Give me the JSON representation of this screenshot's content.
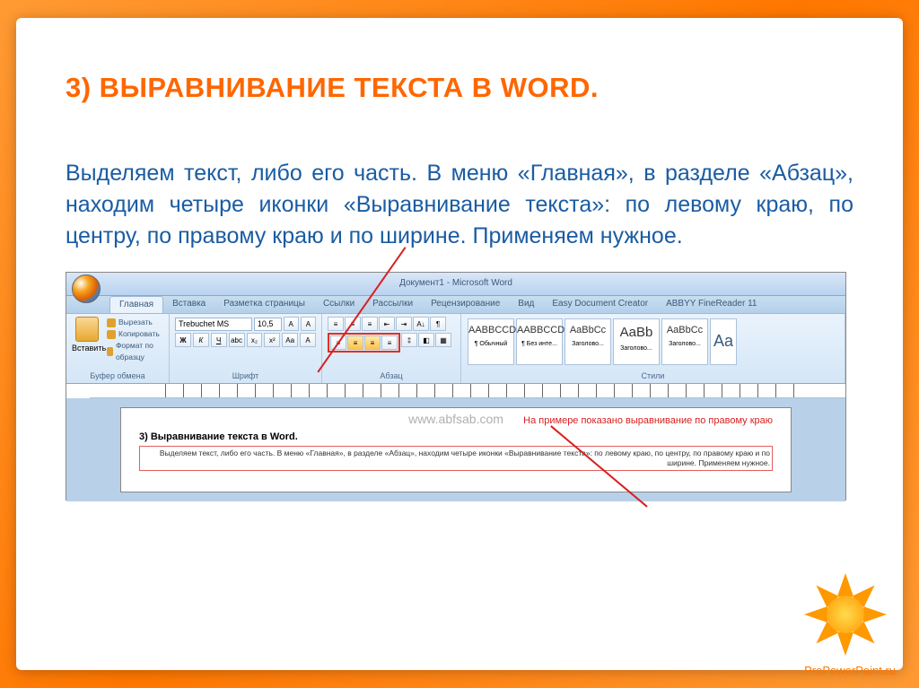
{
  "slide": {
    "title": "3) ВЫРАВНИВАНИЕ ТЕКСТА В WORD.",
    "body": "Выделяем текст, либо его часть. В меню «Главная», в разделе «Абзац», находим четыре иконки «Выравнивание текста»: по левому краю, по центру, по правому краю и по ширине. Применяем нужное."
  },
  "word": {
    "window_title": "Документ1 - Microsoft Word",
    "tabs": [
      "Главная",
      "Вставка",
      "Разметка страницы",
      "Ссылки",
      "Рассылки",
      "Рецензирование",
      "Вид",
      "Easy Document Creator",
      "ABBYY FineReader 11"
    ],
    "clipboard": {
      "paste": "Вставить",
      "cut": "Вырезать",
      "copy": "Копировать",
      "format": "Формат по образцу",
      "group": "Буфер обмена"
    },
    "font": {
      "name": "Trebuchet MS",
      "size": "10,5",
      "group": "Шрифт"
    },
    "paragraph": {
      "group": "Абзац"
    },
    "styles": {
      "group": "Стили",
      "items": [
        "¶ Обычный",
        "¶ Без инте...",
        "Заголово...",
        "Заголово...",
        "Заголово..."
      ],
      "sample_caps": "AABBCCDC",
      "sample_mixed": "AaBbCc",
      "sample_title": "AaBb"
    }
  },
  "doc": {
    "watermark": "www.abfsab.com",
    "note": "На примере показано выравнивание по правому краю",
    "title": "3) Выравнивание текста в Word.",
    "body": "Выделяем текст, либо его часть. В меню «Главная», в разделе «Абзац», находим четыре иконки «Выравнивание текста»: по левому краю, по центру, по правому краю и по ширине. Применяем нужное."
  },
  "footer": "ProPowerPoint.ru"
}
